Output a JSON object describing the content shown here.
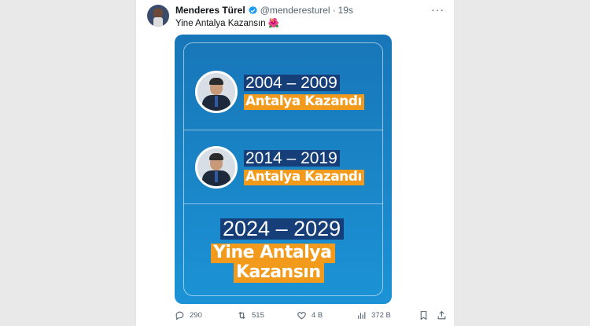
{
  "author": {
    "name": "Menderes Türel",
    "handle": "@menderesturel",
    "separator": "·",
    "time": "19s"
  },
  "tweet": {
    "text": "Yine Antalya Kazansın 🌺"
  },
  "media": {
    "block1": {
      "years": "2004 – 2009",
      "tag": "Antalya Kazandı"
    },
    "block2": {
      "years": "2014 – 2019",
      "tag": "Antalya Kazandı"
    },
    "block3": {
      "years": "2024 – 2029",
      "tag_line1": "Yine Antalya",
      "tag_line2": "Kazansın"
    },
    "colors": {
      "background": "#1a86c8",
      "year_band": "#163f7a",
      "tag_band": "#f29a1c"
    }
  },
  "actions": {
    "replies": "290",
    "reposts": "515",
    "likes": "4 B",
    "views": "372 B"
  },
  "icons": [
    "more-icon",
    "verified-icon",
    "reply-icon",
    "repost-icon",
    "like-icon",
    "views-icon",
    "bookmark-icon",
    "share-icon"
  ]
}
